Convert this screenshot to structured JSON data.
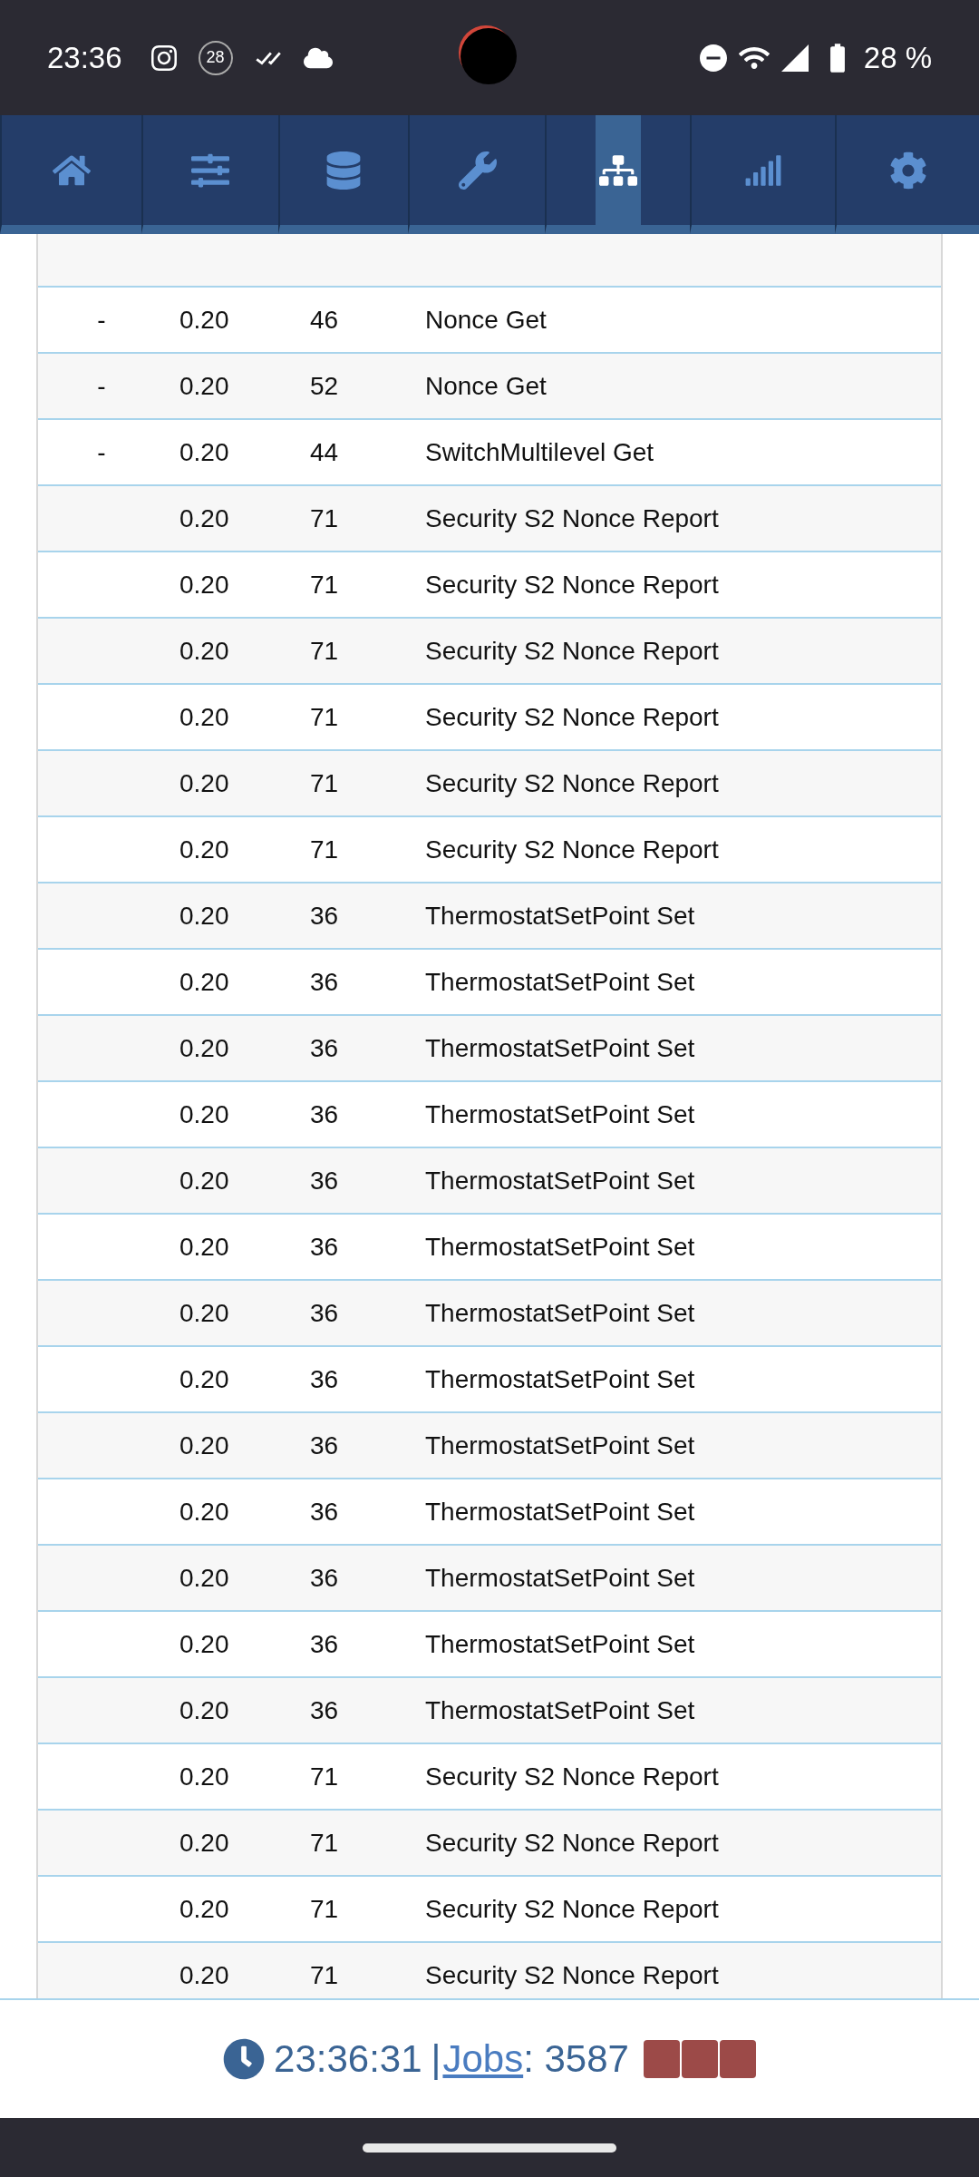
{
  "status_bar": {
    "time": "23:36",
    "notification_badge": "28",
    "battery": "28 %"
  },
  "tabs": [
    {
      "selected": false
    },
    {
      "selected": false
    },
    {
      "selected": false
    },
    {
      "selected": false
    },
    {
      "selected": true
    },
    {
      "selected": false
    },
    {
      "selected": false
    }
  ],
  "table": {
    "rows": [
      {
        "column_1": "-",
        "column_2": "0.20",
        "column_3": "46",
        "column_4": "Nonce Get"
      },
      {
        "column_1": "-",
        "column_2": "0.20",
        "column_3": "52",
        "column_4": "Nonce Get"
      },
      {
        "column_1": "-",
        "column_2": "0.20",
        "column_3": "44",
        "column_4": "SwitchMultilevel Get"
      },
      {
        "column_2": "0.20",
        "column_3": "71",
        "column_4": "Security S2 Nonce Report"
      },
      {
        "column_2": "0.20",
        "column_3": "71",
        "column_4": "Security S2 Nonce Report"
      },
      {
        "column_2": "0.20",
        "column_3": "71",
        "column_4": "Security S2 Nonce Report"
      },
      {
        "column_2": "0.20",
        "column_3": "71",
        "column_4": "Security S2 Nonce Report"
      },
      {
        "column_2": "0.20",
        "column_3": "71",
        "column_4": "Security S2 Nonce Report"
      },
      {
        "column_2": "0.20",
        "column_3": "71",
        "column_4": "Security S2 Nonce Report"
      },
      {
        "column_2": "0.20",
        "column_3": "36",
        "column_4": "ThermostatSetPoint Set"
      },
      {
        "column_2": "0.20",
        "column_3": "36",
        "column_4": "ThermostatSetPoint Set"
      },
      {
        "column_2": "0.20",
        "column_3": "36",
        "column_4": "ThermostatSetPoint Set"
      },
      {
        "column_2": "0.20",
        "column_3": "36",
        "column_4": "ThermostatSetPoint Set"
      },
      {
        "column_2": "0.20",
        "column_3": "36",
        "column_4": "ThermostatSetPoint Set"
      },
      {
        "column_2": "0.20",
        "column_3": "36",
        "column_4": "ThermostatSetPoint Set"
      },
      {
        "column_2": "0.20",
        "column_3": "36",
        "column_4": "ThermostatSetPoint Set"
      },
      {
        "column_2": "0.20",
        "column_3": "36",
        "column_4": "ThermostatSetPoint Set"
      },
      {
        "column_2": "0.20",
        "column_3": "36",
        "column_4": "ThermostatSetPoint Set"
      },
      {
        "column_2": "0.20",
        "column_3": "36",
        "column_4": "ThermostatSetPoint Set"
      },
      {
        "column_2": "0.20",
        "column_3": "36",
        "column_4": "ThermostatSetPoint Set"
      },
      {
        "column_2": "0.20",
        "column_3": "36",
        "column_4": "ThermostatSetPoint Set"
      },
      {
        "column_2": "0.20",
        "column_3": "36",
        "column_4": "ThermostatSetPoint Set"
      },
      {
        "column_2": "0.20",
        "column_3": "71",
        "column_4": "Security S2 Nonce Report"
      },
      {
        "column_2": "0.20",
        "column_3": "71",
        "column_4": "Security S2 Nonce Report"
      },
      {
        "column_2": "0.20",
        "column_3": "71",
        "column_4": "Security S2 Nonce Report"
      },
      {
        "column_2": "0.20",
        "column_3": "71",
        "column_4": "Security S2 Nonce Report"
      }
    ]
  },
  "footer": {
    "time": "23:36:31",
    "separator": "|",
    "jobs_link": "Jobs",
    "jobs_count": ": 3587",
    "indicators": [
      {
        "color": "#9c4a48"
      },
      {
        "color": "#9c4a48"
      },
      {
        "color": "#9c4a48"
      }
    ]
  }
}
